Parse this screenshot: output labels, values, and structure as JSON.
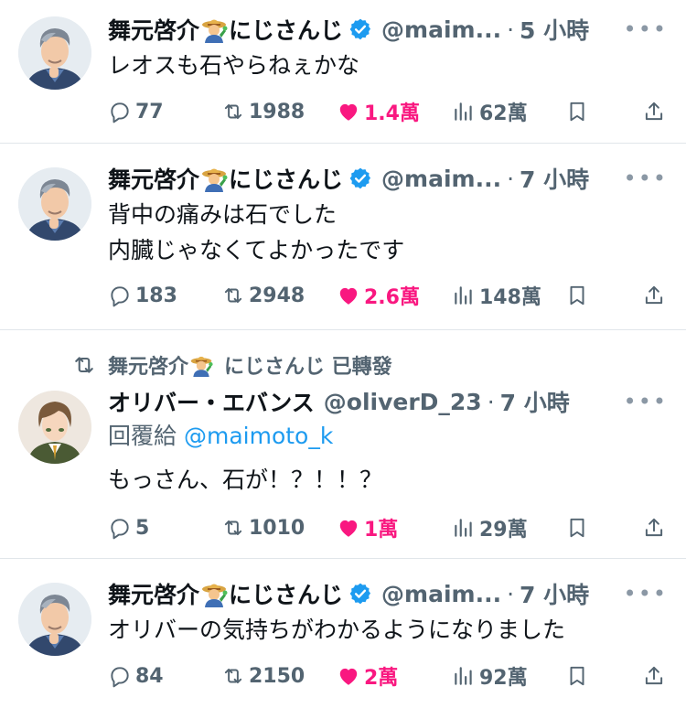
{
  "tweets": [
    {
      "author": "舞元啓介",
      "author_suffix": "にじさんじ",
      "handle": "@maim...",
      "dot": "·",
      "time": "5 小時",
      "text": "レオスも石やらねぇかな",
      "replies": "77",
      "reposts": "1988",
      "likes": "1.4萬",
      "views": "62萬"
    },
    {
      "author": "舞元啓介",
      "author_suffix": "にじさんじ",
      "handle": "@maim...",
      "dot": "·",
      "time": "7 小時",
      "text": "背中の痛みは石でした\n内臓じゃなくてよかったです",
      "replies": "183",
      "reposts": "2948",
      "likes": "2.6萬",
      "views": "148萬"
    },
    {
      "repost_by": "舞元啓介",
      "repost_by_suffix": "にじさんじ 已轉發",
      "author": "オリバー・エバンス",
      "handle": "@oliverD_23",
      "dot": "·",
      "time": "7 小時",
      "reply_prefix": "回覆給",
      "reply_mention": "@maimoto_k",
      "text": "もっさん、石が！？！！？",
      "replies": "5",
      "reposts": "1010",
      "likes": "1萬",
      "views": "29萬"
    },
    {
      "author": "舞元啓介",
      "author_suffix": "にじさんじ",
      "handle": "@maim...",
      "dot": "·",
      "time": "7 小時",
      "text": "オリバーの気持ちがわかるようになりました",
      "replies": "84",
      "reposts": "2150",
      "likes": "2萬",
      "views": "92萬"
    }
  ],
  "icons": {
    "more": "more-horizontal-icon",
    "reply": "reply-icon",
    "repost": "repost-icon",
    "like": "heart-filled-icon",
    "views": "views-icon",
    "bookmark": "bookmark-icon",
    "share": "share-icon",
    "verified": "verified-badge-icon",
    "farmer": "farmer-emoji-icon"
  },
  "colors": {
    "text": "#0f1419",
    "secondary": "#536471",
    "like": "#f91880",
    "link": "#1d9bf0",
    "verified": "#1d9bf0",
    "divider": "#e1e6ea"
  }
}
